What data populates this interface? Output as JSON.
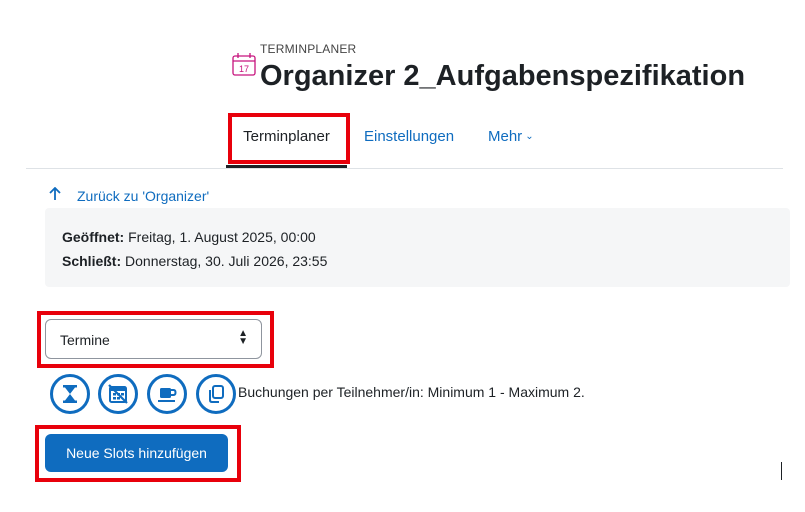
{
  "header": {
    "pre_title": "TERMINPLANER",
    "title": "Organizer 2_Aufgabenspezifikation",
    "calendar_day": "17",
    "icon": "calendar-icon"
  },
  "tabs": [
    {
      "label": "Terminplaner",
      "active": true
    },
    {
      "label": "Einstellungen",
      "active": false
    },
    {
      "label": "Mehr",
      "active": false
    }
  ],
  "back_link": {
    "label": "Zurück zu 'Organizer'",
    "icon": "arrow-up-icon"
  },
  "info": {
    "opened_label": "Geöffnet:",
    "opened_value": " Freitag, 1. August 2025, 00:00",
    "closes_label": "Schließt:",
    "closes_value": " Donnerstag, 30. Juli 2026, 23:55"
  },
  "view_select": {
    "value": "Termine"
  },
  "status_icons": [
    "hourglass-icon",
    "no-calendar-icon",
    "coffee-cup-icon",
    "copy-icon"
  ],
  "limits_text": "Buchungen per Teilnehmer/in: Minimum 1 - Maximum 2.",
  "add_slots_button": "Neue Slots hinzufügen",
  "colors": {
    "link": "#0f6cbf",
    "primary": "#0f6cbf",
    "highlight": "#e8000b",
    "text": "#1d2125"
  }
}
